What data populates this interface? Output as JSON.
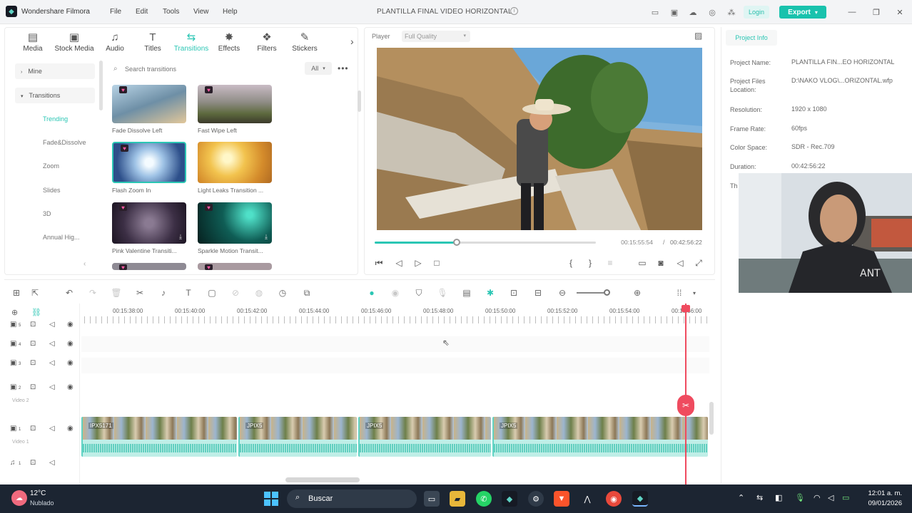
{
  "app": {
    "name": "Wondershare Filmora",
    "project_title": "PLANTILLA FINAL VIDEO HORIZONTAL",
    "menus": [
      "File",
      "Edit",
      "Tools",
      "View",
      "Help"
    ],
    "login_label": "Login",
    "export_label": "Export"
  },
  "media_tabs": [
    {
      "label": "Media",
      "icon": "media-icon"
    },
    {
      "label": "Stock Media",
      "icon": "stock-media-icon"
    },
    {
      "label": "Audio",
      "icon": "music-note-icon"
    },
    {
      "label": "Titles",
      "icon": "text-t-icon"
    },
    {
      "label": "Transitions",
      "icon": "transition-icon",
      "active": true
    },
    {
      "label": "Effects",
      "icon": "effects-icon"
    },
    {
      "label": "Filters",
      "icon": "filters-icon"
    },
    {
      "label": "Stickers",
      "icon": "stickers-icon"
    }
  ],
  "sidebar": {
    "mine": "Mine",
    "transitions": "Transitions",
    "items": [
      "Trending",
      "Fade&Dissolve",
      "Zoom",
      "Slides",
      "3D",
      "Annual Hig..."
    ]
  },
  "search": {
    "placeholder": "Search transitions",
    "filter": "All"
  },
  "transitions": [
    {
      "name": "Fade Dissolve Left",
      "premium": true
    },
    {
      "name": "Fast Wipe Left",
      "premium": true
    },
    {
      "name": "Flash Zoom In",
      "premium": true,
      "selected": true
    },
    {
      "name": "Light Leaks Transition ...",
      "premium": false
    },
    {
      "name": "Pink Valentine Transiti...",
      "premium": true
    },
    {
      "name": "Sparkle Motion Transit...",
      "premium": true
    }
  ],
  "player": {
    "label": "Player",
    "quality": "Full Quality",
    "current_time": "00:15:55:54",
    "total_time": "00:42:56:22",
    "progress": 0.37
  },
  "project_info": {
    "tab": "Project Info",
    "rows": [
      {
        "label": "Project Name:",
        "value": "PLANTILLA FIN...EO HORIZONTAL"
      },
      {
        "label": "Project Files Location:",
        "value": "D:\\NAKO VLOG\\...ORIZONTAL.wfp"
      },
      {
        "label": "Resolution:",
        "value": "1920 x 1080"
      },
      {
        "label": "Frame Rate:",
        "value": "60fps"
      },
      {
        "label": "Color Space:",
        "value": "SDR - Rec.709"
      },
      {
        "label": "Duration:",
        "value": "00:42:56:22"
      },
      {
        "label": "Th",
        "value": ""
      }
    ]
  },
  "timeline": {
    "ruler": [
      "00:15:38:00",
      "00:15:40:00",
      "00:15:42:00",
      "00:15:44:00",
      "00:15:46:00",
      "00:15:48:00",
      "00:15:50:00",
      "00:15:52:00",
      "00:15:54:00",
      "00:15:56:00"
    ],
    "tracks": [
      {
        "num": "5",
        "label": ""
      },
      {
        "num": "4",
        "label": ""
      },
      {
        "num": "3",
        "label": ""
      },
      {
        "num": "2",
        "label": "Video 2"
      },
      {
        "num": "1",
        "label": "Video 1"
      },
      {
        "num": "1",
        "label": ""
      }
    ],
    "clips": [
      "IPX5171",
      "JPIX5",
      "JPIX5",
      "JPIX5"
    ]
  },
  "taskbar": {
    "temperature": "12°C",
    "condition": "Nublado",
    "search": "Buscar",
    "time": "12:01 a. m.",
    "date": "09/01/2026"
  },
  "colors": {
    "accent": "#19c2ad",
    "playhead": "#ef4b5f",
    "taskbar": "#1c2532"
  }
}
